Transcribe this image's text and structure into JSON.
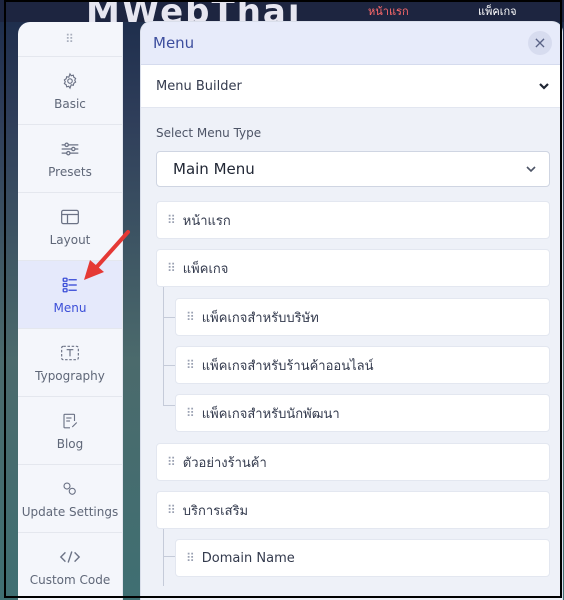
{
  "site_backdrop": {
    "logo_text": "MWebThai",
    "nav_a": "หน้าแรก",
    "nav_b": "แพ็คเกจ"
  },
  "sidebar": {
    "drag_glyph": "⠿",
    "items": [
      {
        "label": "Basic",
        "icon": "gear-icon",
        "active": false
      },
      {
        "label": "Presets",
        "icon": "sliders-icon",
        "active": false
      },
      {
        "label": "Layout",
        "icon": "layout-icon",
        "active": false
      },
      {
        "label": "Menu",
        "icon": "menu-list-icon",
        "active": true
      },
      {
        "label": "Typography",
        "icon": "typography-icon",
        "active": false
      },
      {
        "label": "Blog",
        "icon": "blog-icon",
        "active": false
      },
      {
        "label": "Update Settings",
        "icon": "update-icon",
        "active": false
      },
      {
        "label": "Custom Code",
        "icon": "code-icon",
        "active": false
      }
    ]
  },
  "panel": {
    "title": "Menu",
    "close_glyph": "×",
    "builder_label": "Menu Builder",
    "select_label": "Select Menu Type",
    "select_value": "Main Menu",
    "handle_glyph": "⠿",
    "items": [
      {
        "label": "หน้าแรก",
        "level": 0
      },
      {
        "label": "แพ็คเกจ",
        "level": 0
      },
      {
        "label": "แพ็คเกจสำหรับบริษัท",
        "level": 1
      },
      {
        "label": "แพ็คเกจสำหรับร้านค้าออนไลน์",
        "level": 1
      },
      {
        "label": "แพ็คเกจสำหรับนักพัฒนา",
        "level": 1
      },
      {
        "label": "ตัวอย่างร้านค้า",
        "level": 0
      },
      {
        "label": "บริการเสริม",
        "level": 0
      },
      {
        "label": "Domain Name",
        "level": 1
      }
    ]
  },
  "colors": {
    "accent": "#3c4fd8",
    "annotation_arrow": "#e53935"
  }
}
